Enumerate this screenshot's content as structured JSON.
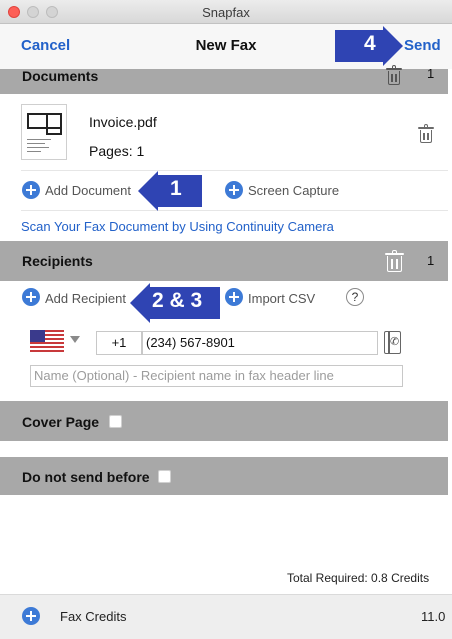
{
  "window": {
    "title": "Snapfax"
  },
  "nav": {
    "cancel": "Cancel",
    "title": "New Fax",
    "send": "Send"
  },
  "documents": {
    "header": "Documents",
    "count": "1",
    "file": {
      "name": "Invoice.pdf",
      "pages": "Pages: 1"
    },
    "add_document": "Add Document",
    "screen_capture": "Screen Capture",
    "continuity_link": "Scan Your Fax Document by Using Continuity Camera"
  },
  "recipients": {
    "header": "Recipients",
    "count": "1",
    "add_recipient": "Add Recipient",
    "import_csv": "Import CSV",
    "help": "?",
    "country_code": "+1",
    "phone": "(234) 567-8901",
    "name_placeholder": "Name (Optional) - Recipient name in fax header line"
  },
  "cover_page": {
    "label": "Cover Page",
    "checked": false
  },
  "do_not_send_before": {
    "label": "Do not send before",
    "checked": false
  },
  "total": "Total Required: 0.8 Credits",
  "footer": {
    "label": "Fax Credits",
    "value": "11.0"
  },
  "callouts": {
    "step1": "1",
    "step23": "2 & 3",
    "step4": "4"
  },
  "icons": [
    "trash-icon",
    "pdf-thumbnail",
    "plus-circle-icon",
    "help-icon",
    "us-flag-icon",
    "contacts-book-icon",
    "checkbox"
  ],
  "colors": {
    "accent": "#2261c9",
    "callout": "#2f44b3",
    "section_header": "#a8a8a8"
  }
}
